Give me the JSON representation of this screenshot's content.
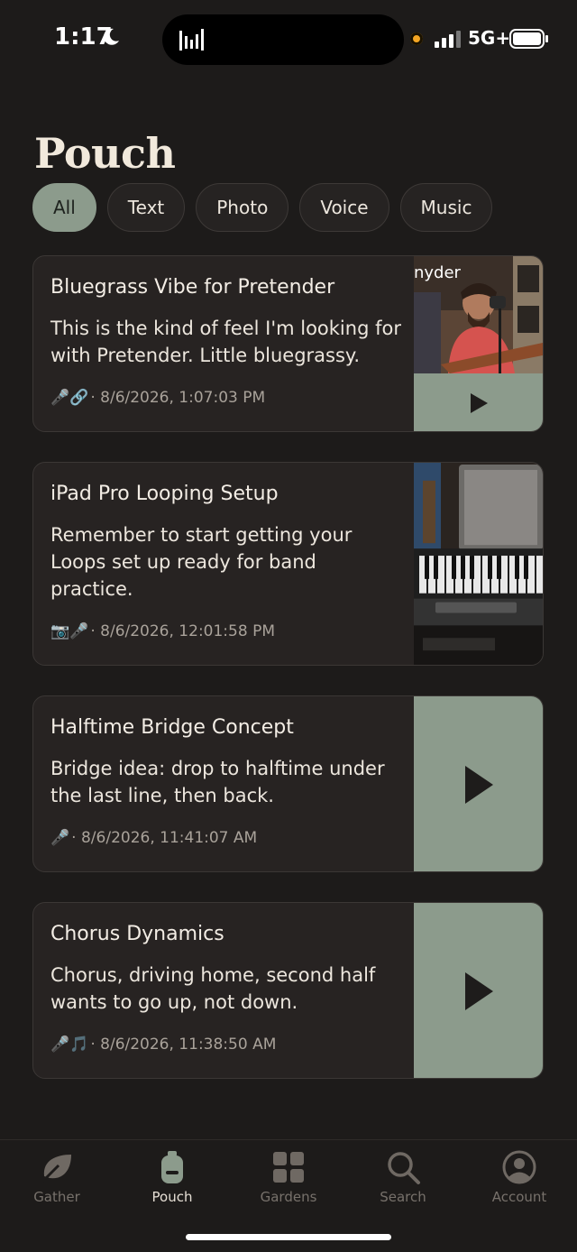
{
  "status_bar": {
    "time": "1:17",
    "network": "5G+"
  },
  "title": "Pouch",
  "filters": [
    "All",
    "Text",
    "Photo",
    "Voice",
    "Music"
  ],
  "cards": [
    {
      "title": "Bluegrass Vibe for Pretender",
      "text": "This is the kind of feel I'm looking for with Pretender. Little bluegrassy.",
      "meta_icons": "🎤🔗",
      "timestamp": "· 8/6/2026, 1:07:03 PM",
      "thumb_text": "nyder"
    },
    {
      "title": "iPad Pro Looping Setup",
      "text": "Remember to start getting your Loops set up ready for band practice.",
      "meta_icons": "📷🎤",
      "timestamp": "· 8/6/2026, 12:01:58 PM"
    },
    {
      "title": "Halftime Bridge Concept",
      "text": "Bridge idea: drop to halftime under the last line, then back.",
      "meta_icons": "🎤",
      "timestamp": "· 8/6/2026, 11:41:07 AM"
    },
    {
      "title": "Chorus Dynamics",
      "text": "Chorus, driving home, second half wants to go up, not down.",
      "meta_icons": "🎤🎵",
      "timestamp": "· 8/6/2026, 11:38:50 AM"
    }
  ],
  "tabs": [
    {
      "label": "Gather",
      "icon": "leaf-icon"
    },
    {
      "label": "Pouch",
      "icon": "pouch-icon"
    },
    {
      "label": "Gardens",
      "icon": "grid-icon"
    },
    {
      "label": "Search",
      "icon": "search-icon"
    },
    {
      "label": "Account",
      "icon": "user-icon"
    }
  ],
  "colors": {
    "background": "#1d1b1a",
    "card": "#272322",
    "accent": "#8c9b8c"
  }
}
